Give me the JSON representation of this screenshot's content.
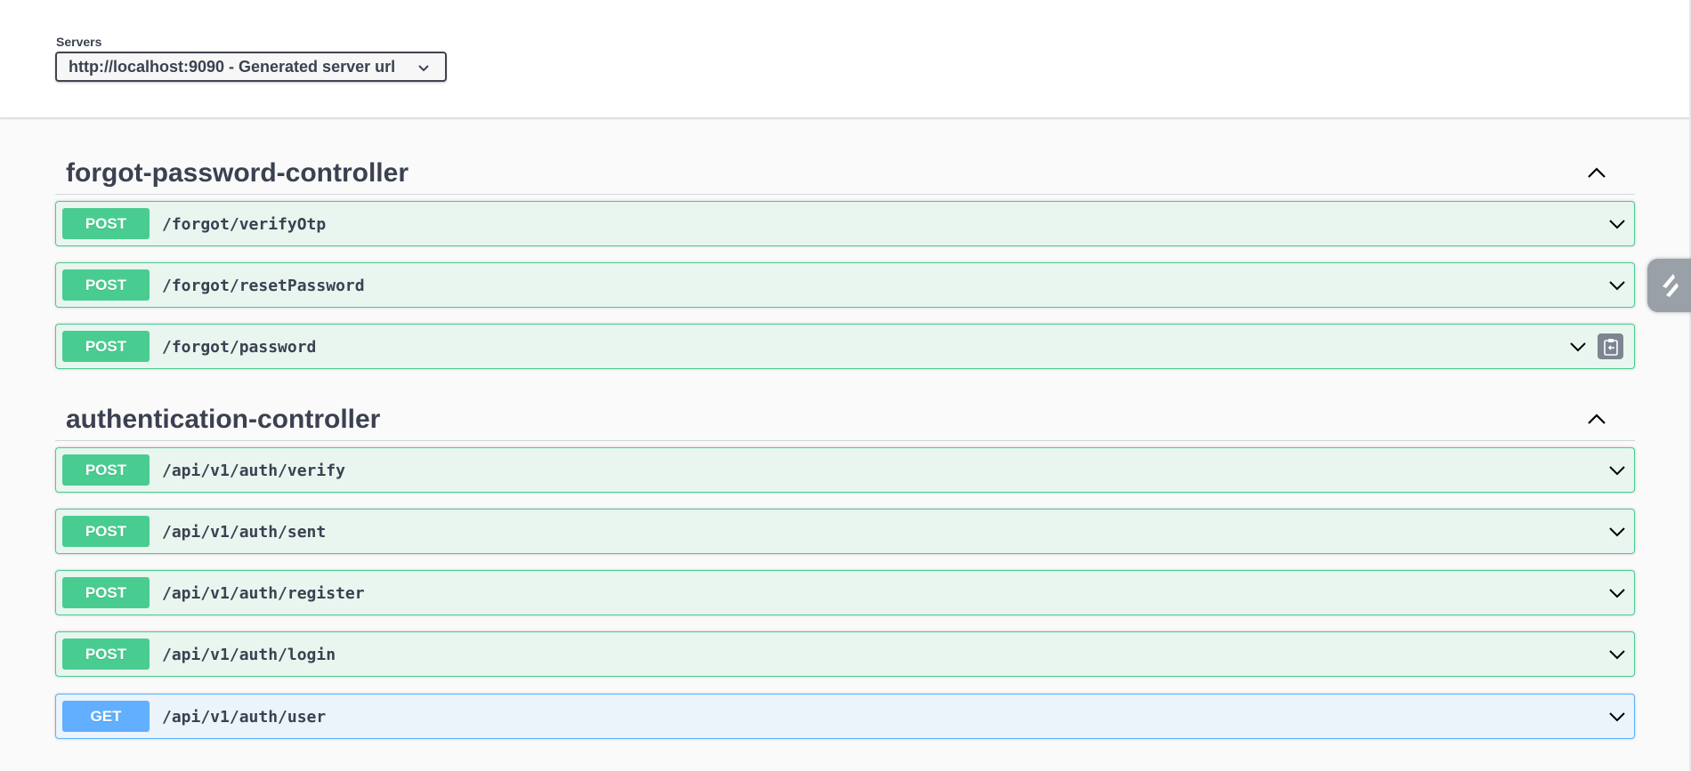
{
  "servers": {
    "label": "Servers",
    "selected": "http://localhost:9090 - Generated server url"
  },
  "tags": [
    {
      "name": "forgot-password-controller",
      "operations": [
        {
          "method": "POST",
          "path": "/forgot/verifyOtp"
        },
        {
          "method": "POST",
          "path": "/forgot/resetPassword"
        },
        {
          "method": "POST",
          "path": "/forgot/password"
        }
      ]
    },
    {
      "name": "authentication-controller",
      "operations": [
        {
          "method": "POST",
          "path": "/api/v1/auth/verify"
        },
        {
          "method": "POST",
          "path": "/api/v1/auth/sent"
        },
        {
          "method": "POST",
          "path": "/api/v1/auth/register"
        },
        {
          "method": "POST",
          "path": "/api/v1/auth/login"
        },
        {
          "method": "GET",
          "path": "/api/v1/auth/user"
        }
      ]
    }
  ],
  "colors": {
    "post": "#49cc90",
    "get": "#61affe",
    "text": "#3b4151"
  },
  "icons": {
    "select_chevron": "chevron-down-icon",
    "tag_toggle": "chevron-up-icon",
    "op_expand": "chevron-down-icon",
    "copy": "clipboard-copy-icon",
    "side_handle": "lightning-icon"
  }
}
